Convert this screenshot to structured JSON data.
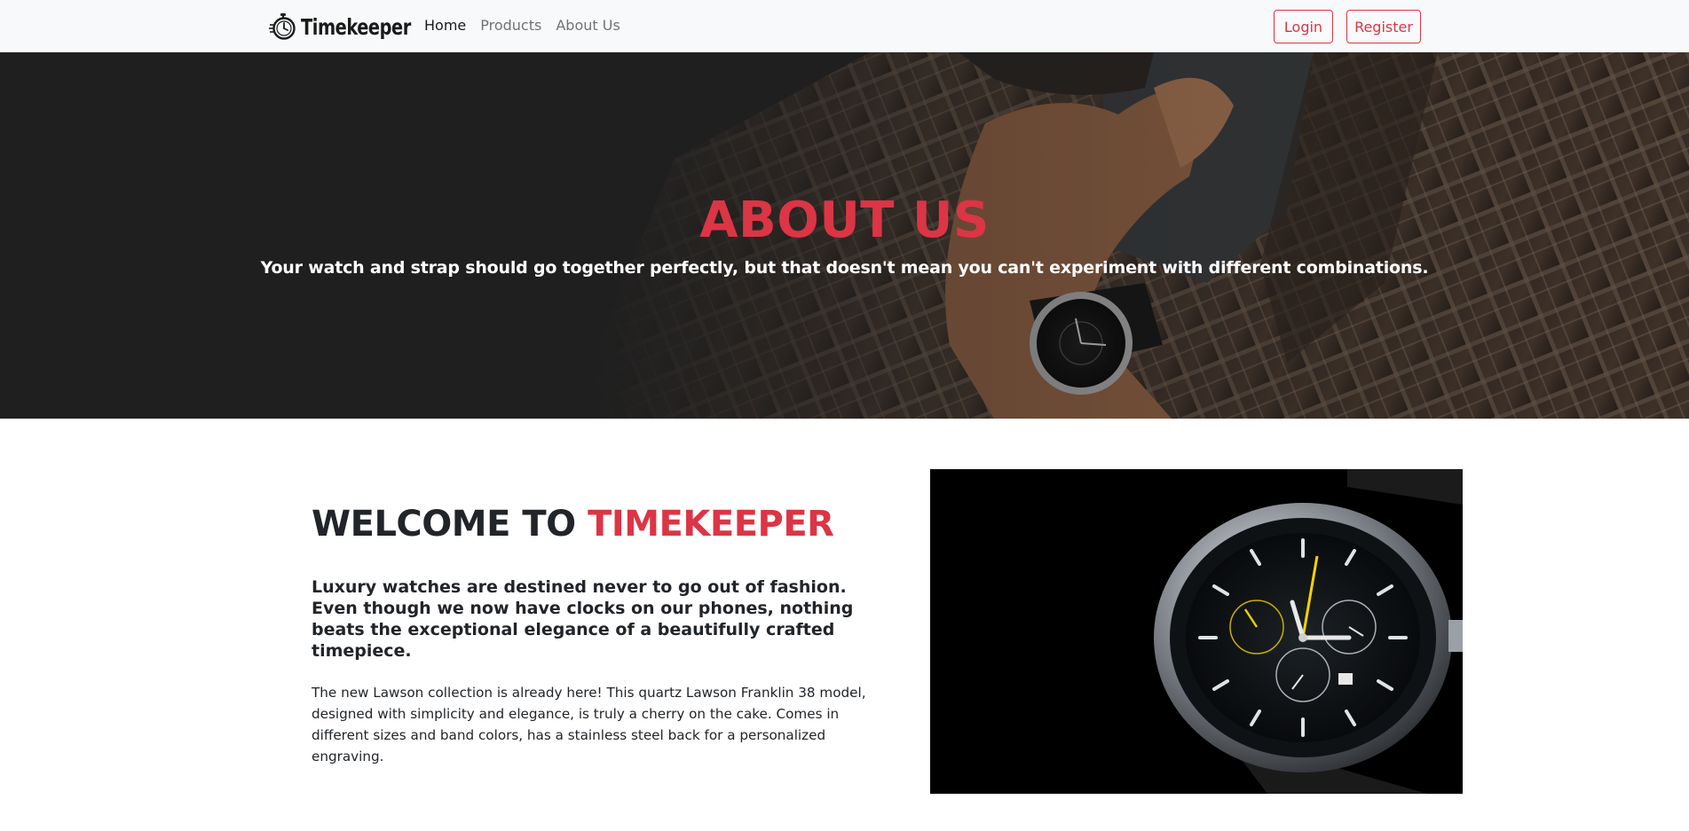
{
  "navbar": {
    "brand": {
      "icon": "stopwatch-icon",
      "name": "Timekeeper"
    },
    "links": [
      {
        "label": "Home",
        "active": true
      },
      {
        "label": "Products",
        "active": false
      },
      {
        "label": "About Us",
        "active": false
      }
    ],
    "login_label": "Login",
    "register_label": "Register"
  },
  "hero": {
    "title": "ABOUT US",
    "subtitle": "Your watch and strap should go together perfectly, but that doesn't mean you can't experiment with different combinations."
  },
  "welcome": {
    "title_prefix": "WELCOME TO",
    "title_accent": "TIMEKEEPER",
    "lead": "Luxury watches are destined never to go out of fashion. Even though we now have clocks on our phones, nothing beats the exceptional elegance of a beautifully crafted timepiece.",
    "body": "The new Lawson collection is already here! This quartz Lawson Franklin 38 model, designed with simplicity and elegance, is truly a cherry on the cake. Comes in different sizes and band colors, has a stainless steel back for a personalized engraving."
  },
  "colors": {
    "accent": "#dc3545",
    "navbar_bg": "#f8f9fa",
    "hero_bg": "#242424"
  }
}
